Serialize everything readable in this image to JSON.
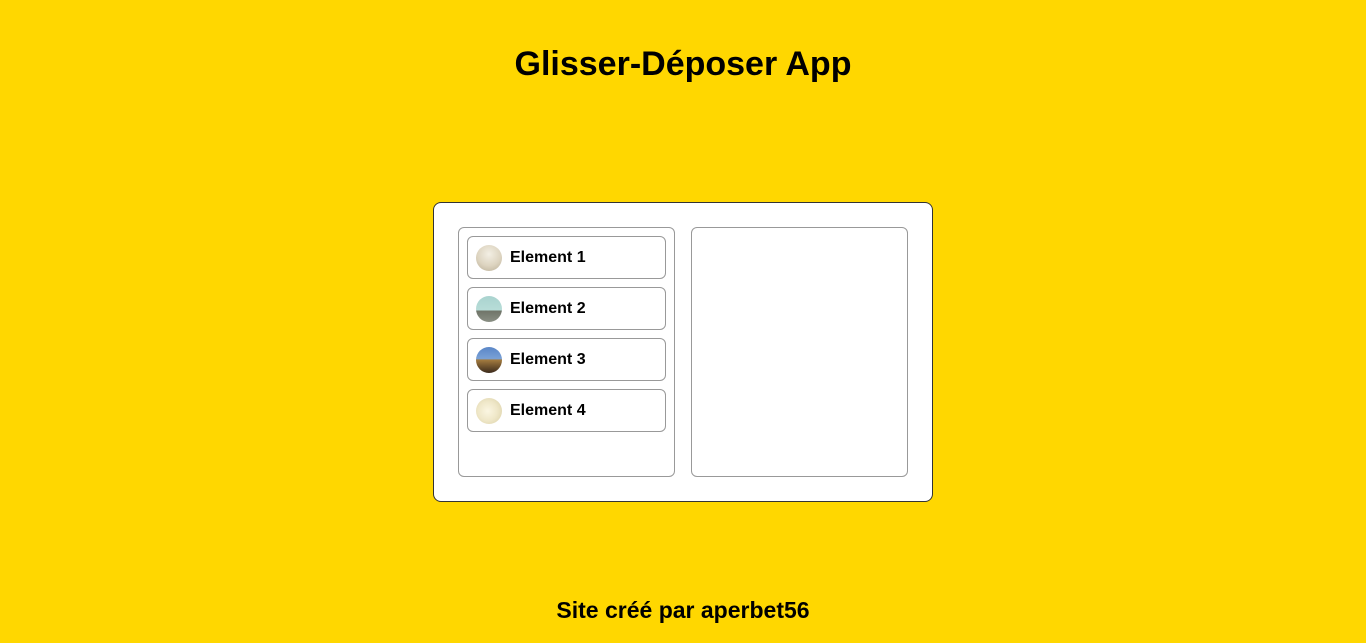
{
  "header": {
    "title": "Glisser-Déposer App"
  },
  "board": {
    "source_items": [
      {
        "label": "Element 1",
        "icon": "sand-dunes-thumbnail"
      },
      {
        "label": "Element 2",
        "icon": "landscape-thumbnail"
      },
      {
        "label": "Element 3",
        "icon": "desert-sunset-thumbnail"
      },
      {
        "label": "Element 4",
        "icon": "drawing-thumbnail"
      }
    ],
    "target_items": []
  },
  "footer": {
    "credit": "Site créé par aperbet56"
  },
  "colors": {
    "background": "#FFD700",
    "panel": "#FFFFFF",
    "border": "#999999"
  }
}
